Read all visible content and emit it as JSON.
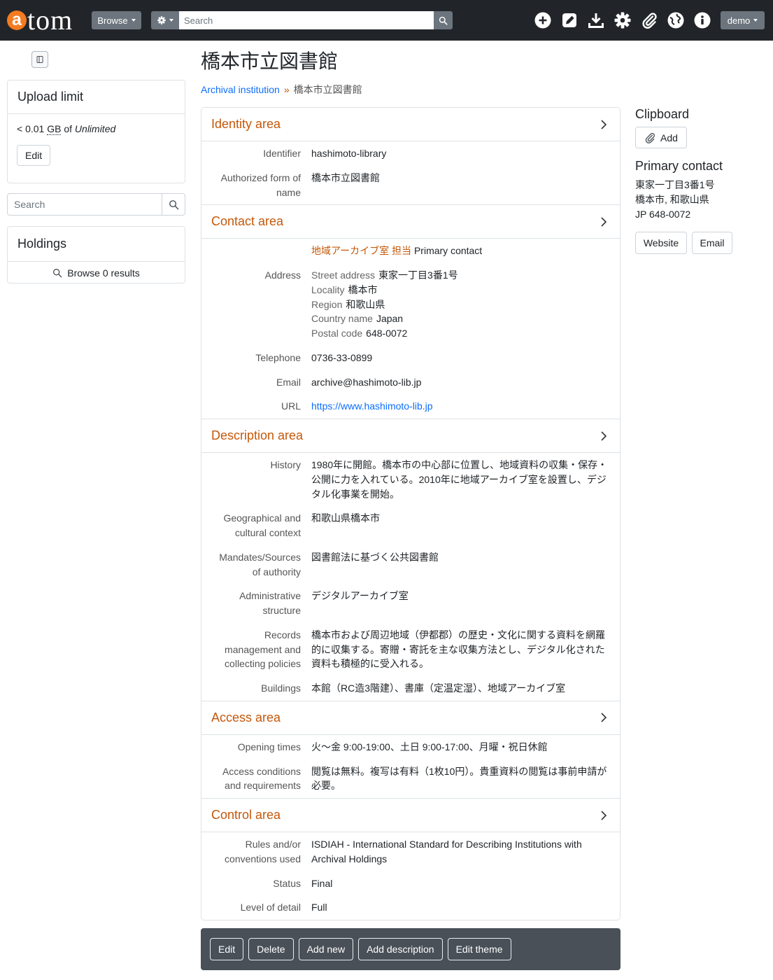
{
  "colors": {
    "accent": "#c4580a",
    "link": "#0d6efd",
    "navbar": "#212529",
    "action_bar": "#495057",
    "logo": "#f47b20"
  },
  "navbar": {
    "logo_letter": "a",
    "logo_rest": "tom",
    "browse_label": "Browse",
    "search_placeholder": "Search",
    "user_label": "demo",
    "icons": [
      "gear-icon",
      "search-icon",
      "plus-circle-icon",
      "edit-icon",
      "download-icon",
      "settings-gear-icon",
      "paperclip-icon",
      "globe-icon",
      "info-icon",
      "caret-down-icon"
    ]
  },
  "sidebar": {
    "upload_limit": {
      "title": "Upload limit",
      "usage": "< 0.01",
      "unit": "GB",
      "of": "of",
      "limit": "Unlimited",
      "edit_label": "Edit"
    },
    "search_placeholder": "Search",
    "holdings": {
      "title": "Holdings",
      "browse_label": "Browse 0 results"
    }
  },
  "main": {
    "title": "橋本市立図書館",
    "breadcrumb": {
      "parent": "Archival institution",
      "separator": "»",
      "current": "橋本市立図書館"
    },
    "identity": {
      "title": "Identity area",
      "fields": [
        {
          "label": "Identifier",
          "value": "hashimoto-library"
        },
        {
          "label": "Authorized form of name",
          "value": "橋本市立図書館"
        }
      ]
    },
    "contact": {
      "title": "Contact area",
      "contact_person": "地域アーカイブ室 担当",
      "contact_type": "Primary contact",
      "address_label": "Address",
      "address": [
        {
          "label": "Street address",
          "value": "東家一丁目3番1号"
        },
        {
          "label": "Locality",
          "value": "橋本市"
        },
        {
          "label": "Region",
          "value": "和歌山県"
        },
        {
          "label": "Country name",
          "value": "Japan"
        },
        {
          "label": "Postal code",
          "value": "648-0072"
        }
      ],
      "telephone": {
        "label": "Telephone",
        "value": "0736-33-0899"
      },
      "email": {
        "label": "Email",
        "value": "archive@hashimoto-lib.jp"
      },
      "url": {
        "label": "URL",
        "value": "https://www.hashimoto-lib.jp"
      }
    },
    "description": {
      "title": "Description area",
      "fields": [
        {
          "label": "History",
          "value": "1980年に開館。橋本市の中心部に位置し、地域資料の収集・保存・公開に力を入れている。2010年に地域アーカイブ室を設置し、デジタル化事業を開始。"
        },
        {
          "label": "Geographical and cultural context",
          "value": "和歌山県橋本市"
        },
        {
          "label": "Mandates/Sources of authority",
          "value": "図書館法に基づく公共図書館"
        },
        {
          "label": "Administrative structure",
          "value": "デジタルアーカイブ室"
        },
        {
          "label": "Records management and collecting policies",
          "value": "橋本市および周辺地域（伊都郡）の歴史・文化に関する資料を網羅的に収集する。寄贈・寄託を主な収集方法とし、デジタル化された資料も積極的に受入れる。"
        },
        {
          "label": "Buildings",
          "value": "本館（RC造3階建）、書庫（定温定湿）、地域アーカイブ室"
        }
      ]
    },
    "access": {
      "title": "Access area",
      "fields": [
        {
          "label": "Opening times",
          "value": "火〜金 9:00-19:00、土日 9:00-17:00、月曜・祝日休館"
        },
        {
          "label": "Access conditions and requirements",
          "value": "閲覧は無料。複写は有料（1枚10円）。貴重資料の閲覧は事前申請が必要。"
        }
      ]
    },
    "control": {
      "title": "Control area",
      "fields": [
        {
          "label": "Rules and/or conventions used",
          "value": "ISDIAH - International Standard for Describing Institutions with Archival Holdings"
        },
        {
          "label": "Status",
          "value": "Final"
        },
        {
          "label": "Level of detail",
          "value": "Full"
        }
      ]
    }
  },
  "actions": [
    "Edit",
    "Delete",
    "Add new",
    "Add description",
    "Edit theme"
  ],
  "right": {
    "clipboard_title": "Clipboard",
    "clipboard_add": "Add",
    "primary_contact_title": "Primary contact",
    "address_lines": [
      "東家一丁目3番1号",
      "橋本市, 和歌山県",
      "JP 648-0072"
    ],
    "website_label": "Website",
    "email_label": "Email"
  }
}
